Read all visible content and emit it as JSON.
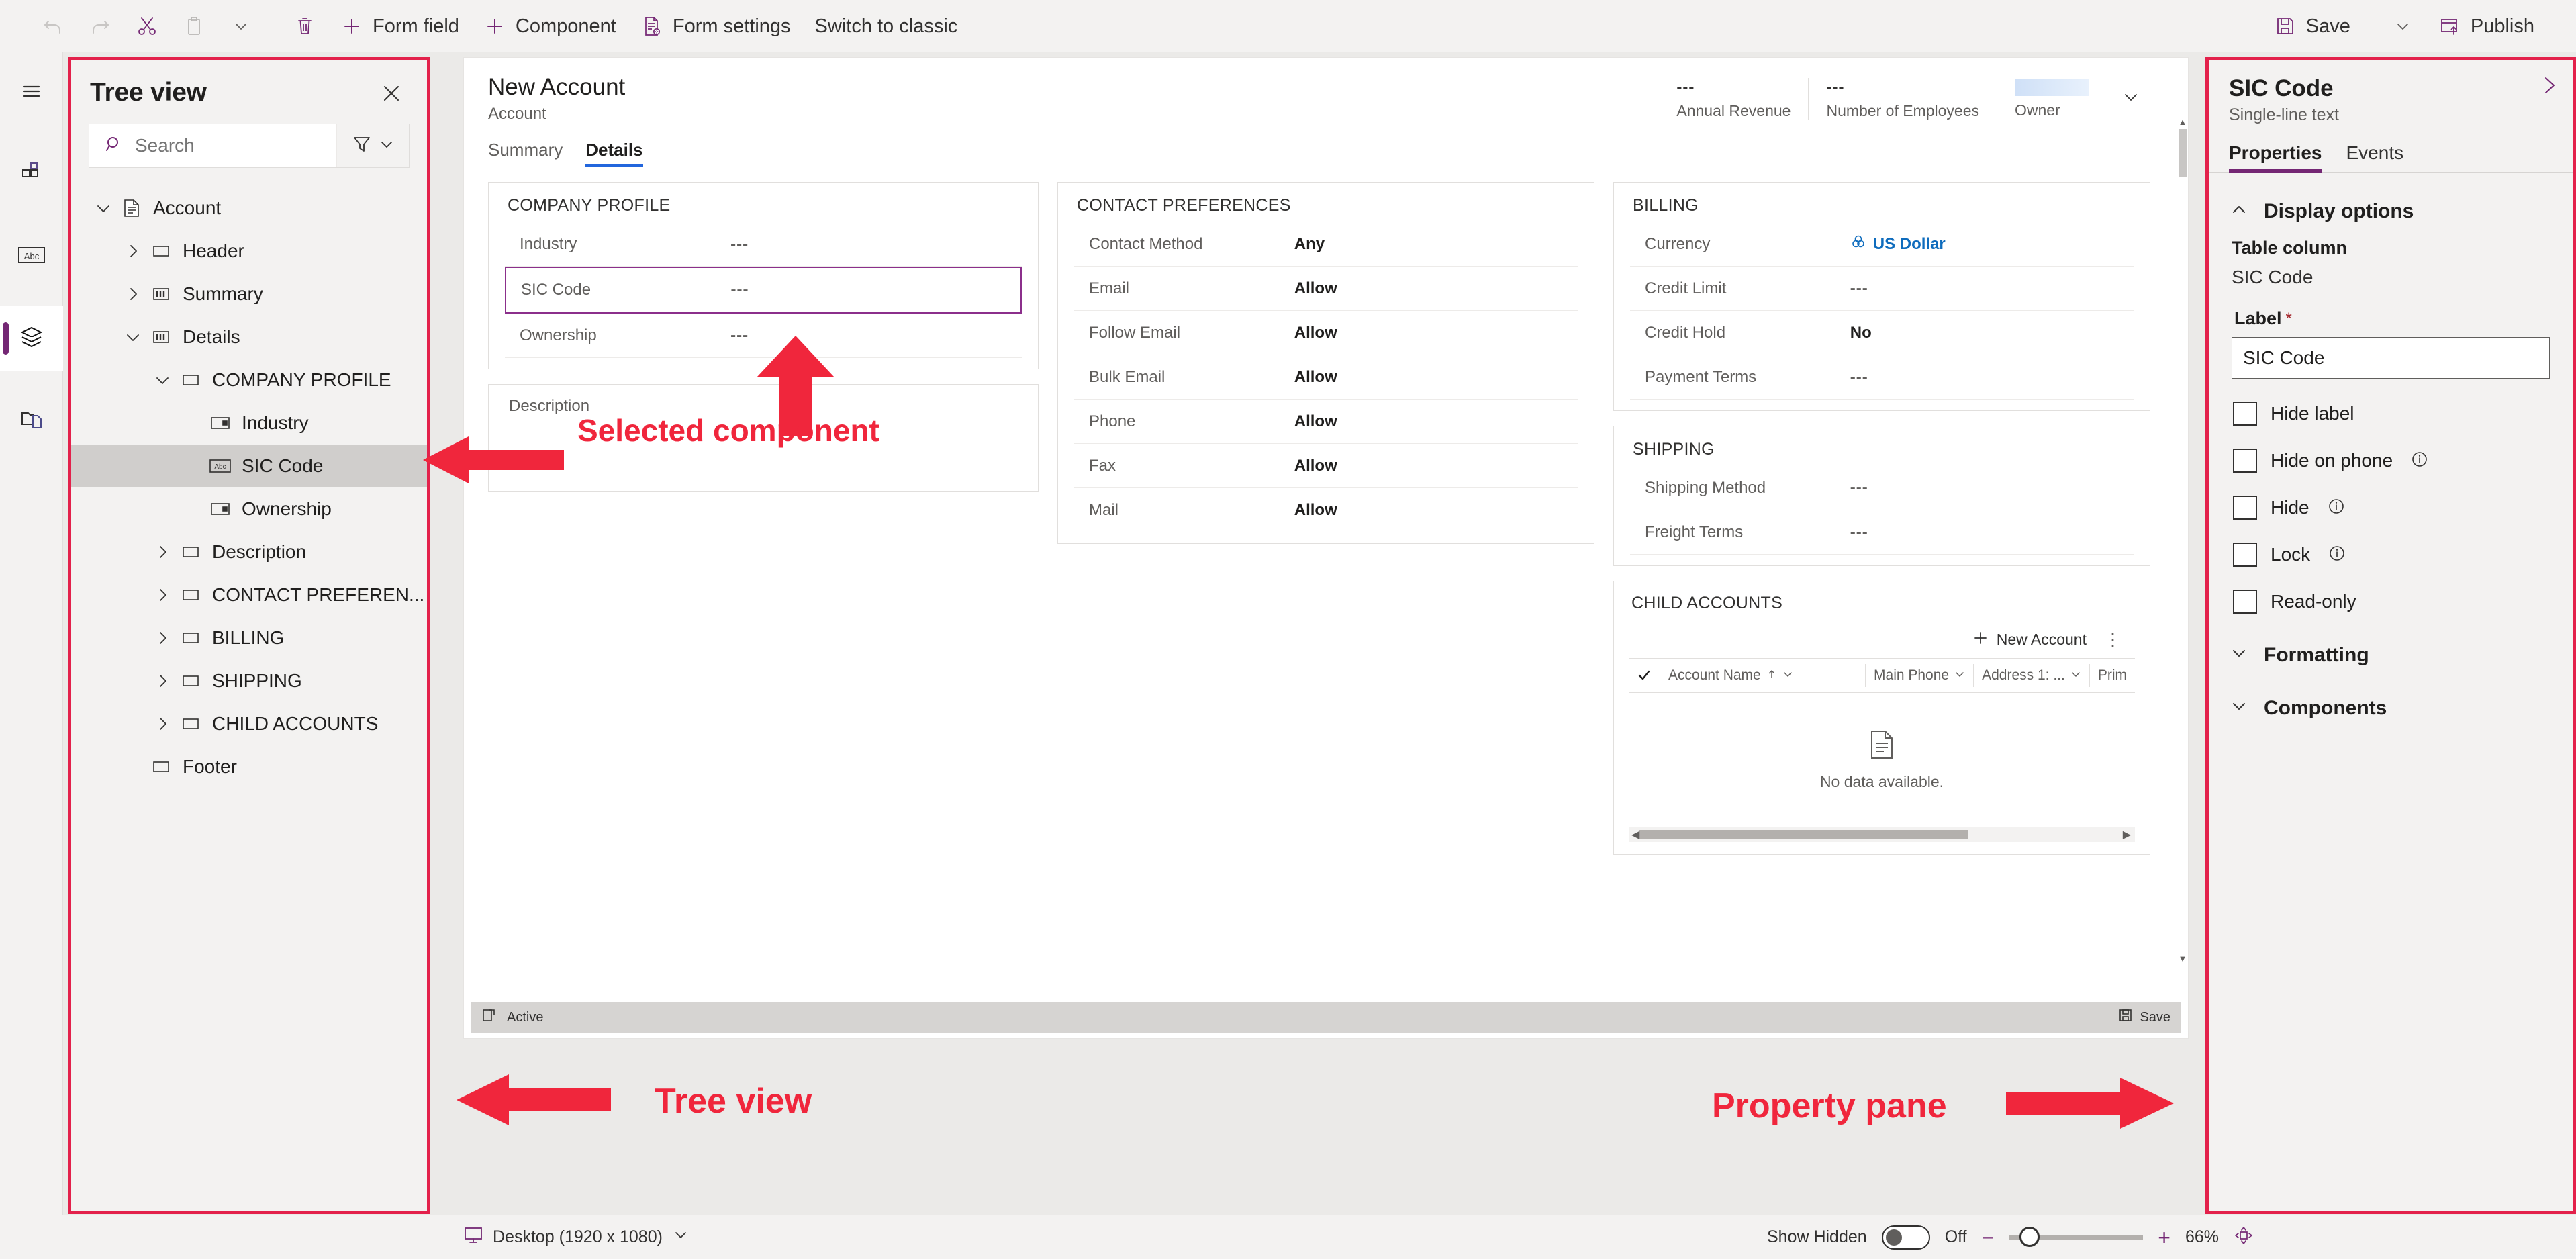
{
  "toolbar": {
    "undo_label": "Undo",
    "redo_label": "Redo",
    "cut_label": "Cut",
    "copy_label": "Copy",
    "copy_menu_label": "More",
    "delete_label": "Delete",
    "form_field_label": "Form field",
    "component_label": "Component",
    "form_settings_label": "Form settings",
    "switch_classic_label": "Switch to classic",
    "save_label": "Save",
    "save_menu_label": "Save options",
    "publish_label": "Publish"
  },
  "rail": {
    "items": [
      {
        "name": "hamburger-menu-icon",
        "tooltip": "Menu"
      },
      {
        "name": "components-icon",
        "tooltip": "Components"
      },
      {
        "name": "table-columns-icon",
        "tooltip": "Table columns"
      },
      {
        "name": "tree-view-icon",
        "tooltip": "Tree view"
      },
      {
        "name": "related-icon",
        "tooltip": "Related"
      }
    ]
  },
  "tree_view": {
    "title": "Tree view",
    "close_label": "Close",
    "search_placeholder": "Search",
    "search_value": "",
    "filter_label": "Filter",
    "nodes": [
      {
        "label": "Account",
        "indent": 0,
        "chevron": "down",
        "icon": "form-icon",
        "selected": false
      },
      {
        "label": "Header",
        "indent": 1,
        "chevron": "right",
        "icon": "section-icon",
        "selected": false
      },
      {
        "label": "Summary",
        "indent": 1,
        "chevron": "right",
        "icon": "tab-icon",
        "selected": false
      },
      {
        "label": "Details",
        "indent": 1,
        "chevron": "down",
        "icon": "tab-icon",
        "selected": false
      },
      {
        "label": "COMPANY PROFILE",
        "indent": 2,
        "chevron": "down",
        "icon": "section-icon",
        "selected": false
      },
      {
        "label": "Industry",
        "indent": 3,
        "chevron": "none",
        "icon": "choice-field-icon",
        "selected": false
      },
      {
        "label": "SIC Code",
        "indent": 3,
        "chevron": "none",
        "icon": "text-field-icon",
        "selected": true
      },
      {
        "label": "Ownership",
        "indent": 3,
        "chevron": "none",
        "icon": "choice-field-icon",
        "selected": false
      },
      {
        "label": "Description",
        "indent": 2,
        "chevron": "right",
        "icon": "section-icon",
        "selected": false
      },
      {
        "label": "CONTACT PREFEREN...",
        "indent": 2,
        "chevron": "right",
        "icon": "section-icon",
        "selected": false
      },
      {
        "label": "BILLING",
        "indent": 2,
        "chevron": "right",
        "icon": "section-icon",
        "selected": false
      },
      {
        "label": "SHIPPING",
        "indent": 2,
        "chevron": "right",
        "icon": "section-icon",
        "selected": false
      },
      {
        "label": "CHILD ACCOUNTS",
        "indent": 2,
        "chevron": "right",
        "icon": "section-icon",
        "selected": false
      },
      {
        "label": "Footer",
        "indent": 1,
        "chevron": "none",
        "icon": "section-icon",
        "selected": false
      }
    ]
  },
  "canvas": {
    "record_title": "New Account",
    "record_subtitle": "Account",
    "header_fields": [
      {
        "value": "---",
        "label": "Annual Revenue"
      },
      {
        "value": "---",
        "label": "Number of Employees"
      },
      {
        "value": "",
        "label": "Owner"
      }
    ],
    "header_chevron_label": "Expand header",
    "tabs": [
      {
        "label": "Summary",
        "active": false
      },
      {
        "label": "Details",
        "active": true
      }
    ],
    "sections": {
      "company_profile": {
        "title": "COMPANY PROFILE",
        "fields": [
          {
            "label": "Industry",
            "value": "---",
            "selected": false
          },
          {
            "label": "SIC Code",
            "value": "---",
            "selected": true
          },
          {
            "label": "Ownership",
            "value": "---",
            "selected": false
          }
        ]
      },
      "description": {
        "label": "Description",
        "value": ""
      },
      "contact_preferences": {
        "title": "CONTACT PREFERENCES",
        "fields": [
          {
            "label": "Contact Method",
            "value": "Any"
          },
          {
            "label": "Email",
            "value": "Allow"
          },
          {
            "label": "Follow Email",
            "value": "Allow"
          },
          {
            "label": "Bulk Email",
            "value": "Allow"
          },
          {
            "label": "Phone",
            "value": "Allow"
          },
          {
            "label": "Fax",
            "value": "Allow"
          },
          {
            "label": "Mail",
            "value": "Allow"
          }
        ]
      },
      "billing": {
        "title": "BILLING",
        "fields": [
          {
            "label": "Currency",
            "value": "US Dollar",
            "is_link": true
          },
          {
            "label": "Credit Limit",
            "value": "---"
          },
          {
            "label": "Credit Hold",
            "value": "No"
          },
          {
            "label": "Payment Terms",
            "value": "---"
          }
        ]
      },
      "shipping": {
        "title": "SHIPPING",
        "fields": [
          {
            "label": "Shipping Method",
            "value": "---"
          },
          {
            "label": "Freight Terms",
            "value": "---"
          }
        ]
      },
      "child_accounts": {
        "title": "CHILD ACCOUNTS",
        "new_button_label": "New Account",
        "more_label": "More commands",
        "columns": [
          "Account Name",
          "Main Phone",
          "Address 1: ...",
          "Prim"
        ],
        "sort_column": "Account Name",
        "sort_direction": "ascending",
        "empty_text": "No data available."
      }
    },
    "footer": {
      "status_label": "Active",
      "save_label": "Save"
    }
  },
  "property_pane": {
    "title": "SIC Code",
    "subtitle": "Single-line text",
    "expand_label": "Expand pane",
    "tabs": [
      {
        "label": "Properties",
        "active": true
      },
      {
        "label": "Events",
        "active": false
      }
    ],
    "display_options": {
      "group_title": "Display options",
      "group_expanded": true,
      "table_column_label": "Table column",
      "table_column_value": "SIC Code",
      "label_label": "Label",
      "label_required_marker": "*",
      "label_value": "SIC Code",
      "checkboxes": [
        {
          "label": "Hide label",
          "checked": false,
          "info": false
        },
        {
          "label": "Hide on phone",
          "checked": false,
          "info": true
        },
        {
          "label": "Hide",
          "checked": false,
          "info": true
        },
        {
          "label": "Lock",
          "checked": false,
          "info": true
        },
        {
          "label": "Read-only",
          "checked": false,
          "info": false
        }
      ]
    },
    "collapsed_groups": [
      {
        "title": "Formatting"
      },
      {
        "title": "Components"
      }
    ]
  },
  "bottom_bar": {
    "device_label": "Desktop (1920 x 1080)",
    "show_hidden_label": "Show Hidden",
    "show_hidden_state": "Off",
    "zoom_out_label": "Zoom out",
    "zoom_in_label": "Zoom in",
    "zoom_value": "66%",
    "fit_label": "Fit to screen"
  },
  "annotations": [
    {
      "text": "Selected component"
    },
    {
      "text": "Tree view"
    },
    {
      "text": "Property pane"
    }
  ],
  "colors": {
    "accent_purple": "#742774",
    "annotation_red": "#f0263c",
    "border_red": "#e3214b",
    "tab_blue": "#2266dd",
    "link_blue": "#0f6cbd"
  }
}
